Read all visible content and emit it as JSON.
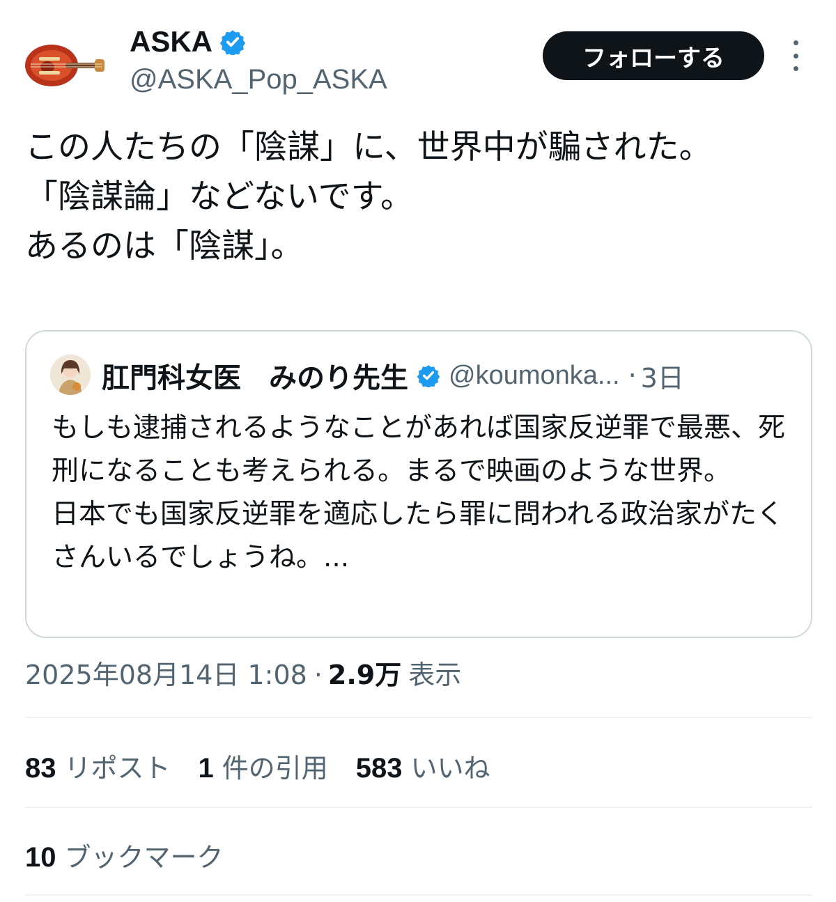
{
  "author": {
    "display_name": "ASKA",
    "handle": "@ASKA_Pop_ASKA",
    "verified_icon": "verified-badge-icon",
    "avatar": "violin-bass-guitar-avatar"
  },
  "follow_button": {
    "label": "フォローする"
  },
  "more_menu_icon": "vertical-ellipsis-icon",
  "tweet": {
    "text": "この人たちの「陰謀」に、世界中が騙された。\n「陰謀論」などないです。\nあるのは「陰謀」。"
  },
  "quote": {
    "display_name": "肛門科女医　みのり先生",
    "handle": "@koumonka...",
    "separator": "·",
    "time": "3日",
    "text": "もしも逮捕されるようなことがあれば国家反逆罪で最悪、死刑になることも考えられる。まるで映画のような世界。\n日本でも国家反逆罪を適応したら罪に問われる政治家がたくさんいるでしょうね。..."
  },
  "meta": {
    "timestamp": "2025年08月14日 1:08",
    "separator": "·",
    "views_count": "2.9万",
    "views_label": "表示"
  },
  "stats": {
    "reposts": {
      "count": "83",
      "label": "リポスト"
    },
    "quotes": {
      "count": "1",
      "label": "件の引用"
    },
    "likes": {
      "count": "583",
      "label": "いいね"
    },
    "bookmarks": {
      "count": "10",
      "label": "ブックマーク"
    }
  },
  "colors": {
    "text_primary": "#0f1419",
    "text_secondary": "#536471",
    "verified_blue": "#1d9bf0",
    "follow_bg": "#0f1419",
    "border": "#cfd9de"
  }
}
